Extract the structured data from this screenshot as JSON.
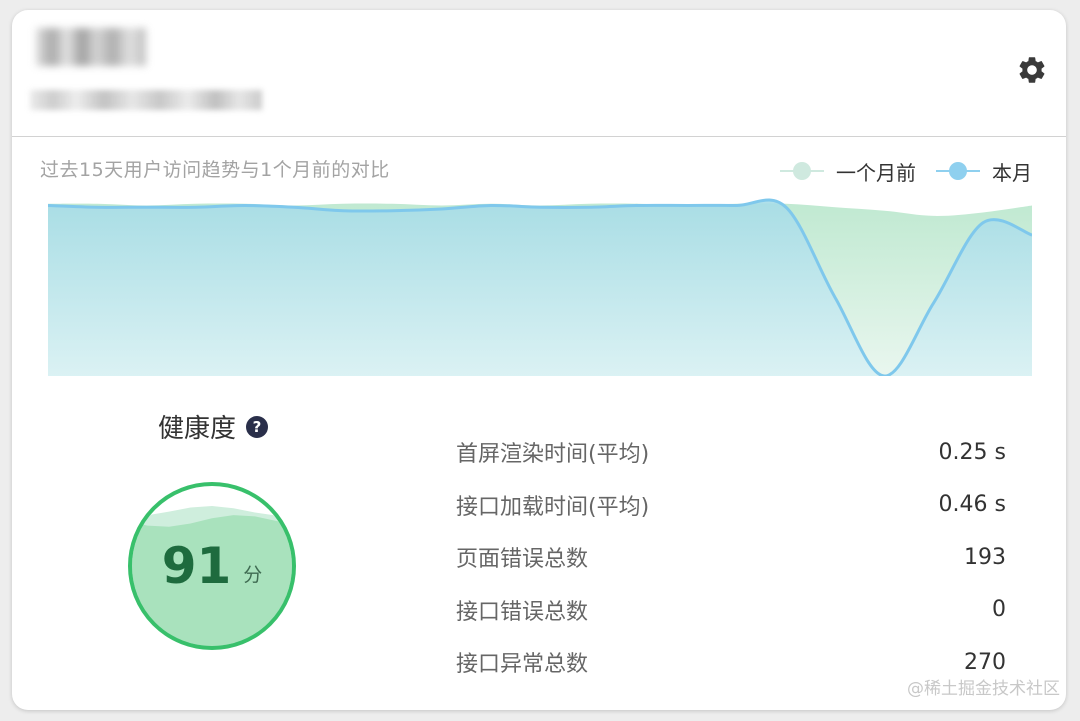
{
  "header": {
    "title": "",
    "subtitle": "",
    "settings_icon": "gear-icon"
  },
  "trend": {
    "title": "过去15天用户访问趋势与1个月前的对比",
    "legend": [
      {
        "label": "一个月前",
        "color": "#cfe9df"
      },
      {
        "label": "本月",
        "color": "#8fd0ef"
      }
    ]
  },
  "chart_data": {
    "type": "area",
    "title": "过去15天用户访问趋势与1个月前的对比",
    "x": [
      0,
      1,
      2,
      3,
      4,
      5,
      6,
      7,
      8,
      9,
      10,
      11,
      12,
      13,
      14,
      15,
      16,
      17,
      18,
      19,
      20
    ],
    "series": [
      {
        "name": "一个月前",
        "color": "#cfe9df",
        "values": [
          0.99,
          0.99,
          0.98,
          0.99,
          0.99,
          0.98,
          0.99,
          0.99,
          0.98,
          0.99,
          0.98,
          0.99,
          0.99,
          0.98,
          0.99,
          0.99,
          0.97,
          0.95,
          0.92,
          0.94,
          0.98
        ]
      },
      {
        "name": "本月",
        "color": "#8fd0ef",
        "values": [
          0.98,
          0.97,
          0.97,
          0.97,
          0.98,
          0.97,
          0.95,
          0.95,
          0.96,
          0.98,
          0.97,
          0.97,
          0.98,
          0.98,
          0.98,
          0.97,
          0.45,
          0.0,
          0.42,
          0.88,
          0.81
        ]
      }
    ],
    "ylim": [
      0,
      1
    ],
    "grid": false,
    "legend_position": "top-right"
  },
  "health": {
    "label": "健康度",
    "help_icon": "question-circle-icon",
    "score": "91",
    "unit": "分",
    "level": 0.91,
    "ring_color": "#38c06b",
    "fill_color": "#a9e2bd"
  },
  "metrics": [
    {
      "name": "首屏渲染时间(平均)",
      "value": "0.25 s"
    },
    {
      "name": "接口加载时间(平均)",
      "value": "0.46 s"
    },
    {
      "name": "页面错误总数",
      "value": "193"
    },
    {
      "name": "接口错误总数",
      "value": "0"
    },
    {
      "name": "接口异常总数",
      "value": "270"
    }
  ],
  "watermark": "@稀土掘金技术社区"
}
